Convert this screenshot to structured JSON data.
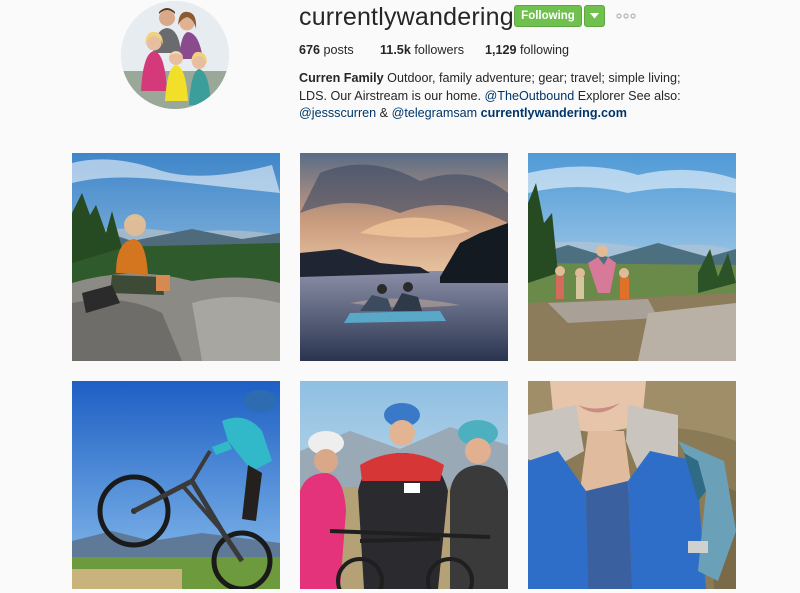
{
  "profile": {
    "username": "currentlywandering",
    "follow_label": "Following",
    "stats": {
      "posts_count": "676",
      "posts_label": "posts",
      "followers_count": "11.5k",
      "followers_label": "followers",
      "following_count": "1,129",
      "following_label": "following"
    },
    "bio": {
      "name": "Curren Family",
      "text1": " Outdoor, family adventure; gear; travel; simple living; LDS. Our Airstream is our home. ",
      "mention1": "@TheOutbound",
      "text2": " Explorer See also: ",
      "mention2": "@jessscurren",
      "text3": " & ",
      "mention3": "@telegramsam",
      "text4": " ",
      "website": "currentlywandering.com"
    }
  },
  "icons": {
    "dropdown": "chevron-down-icon",
    "more": "ellipsis-icon"
  },
  "colors": {
    "follow_green": "#70c050",
    "link_blue": "#003569",
    "background": "#fafafa"
  },
  "posts": [
    {
      "name": "post-boy-mountain-view"
    },
    {
      "name": "post-lake-sunset-pedal-boat"
    },
    {
      "name": "post-kids-on-rocks"
    },
    {
      "name": "post-mountain-bike-wheelie"
    },
    {
      "name": "post-three-women-bikes"
    },
    {
      "name": "post-selfie-blue-vest"
    }
  ]
}
